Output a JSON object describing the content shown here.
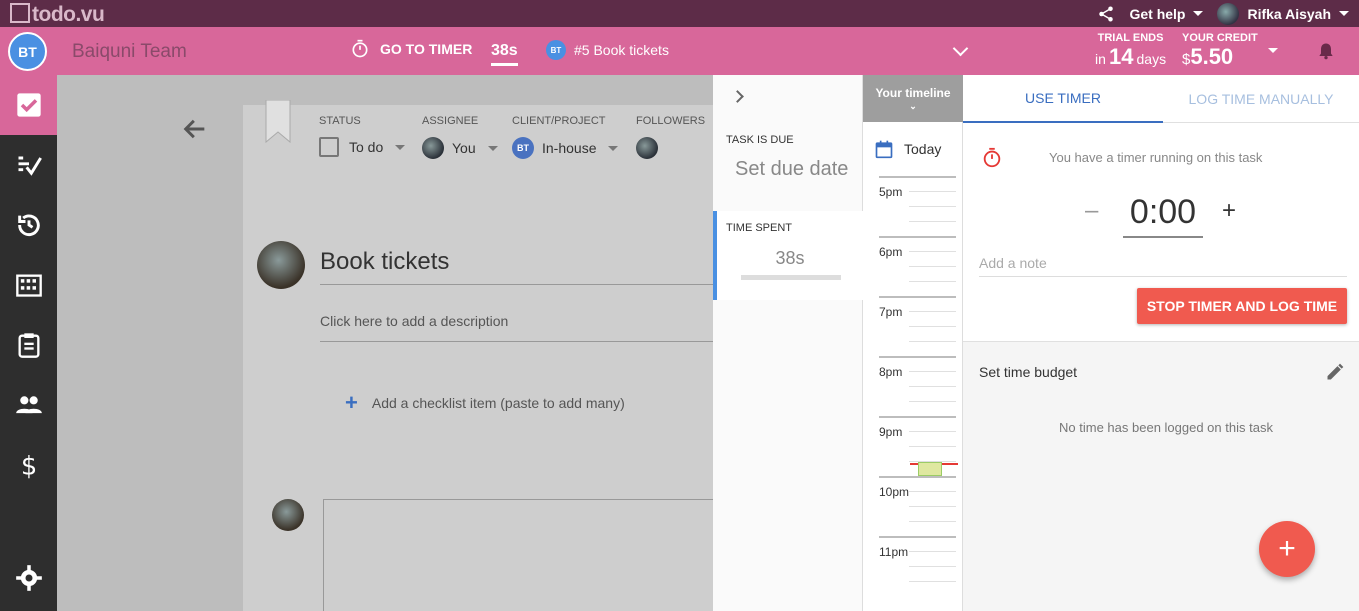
{
  "app": {
    "logo": "todo.vu"
  },
  "topbar": {
    "help_label": "Get help",
    "user_name": "Rifka Aisyah"
  },
  "header": {
    "team_badge": "BT",
    "team_name": "Baiquni Team",
    "goto_timer_label": "GO TO TIMER",
    "timer_value": "38s",
    "task_badge": "BT",
    "task_ref": "#5  Book tickets",
    "trial_label": "TRIAL ENDS",
    "trial_in": "in",
    "trial_days": "14",
    "trial_unit": "days",
    "credit_label": "YOUR CREDIT",
    "credit_currency": "$",
    "credit_amount": "5.50"
  },
  "sidebar": {
    "items": [
      {
        "icon": "check-icon",
        "active": true
      },
      {
        "icon": "tasks-list-icon",
        "active": false
      },
      {
        "icon": "history-icon",
        "active": false
      },
      {
        "icon": "building-icon",
        "active": false
      },
      {
        "icon": "clipboard-icon",
        "active": false
      },
      {
        "icon": "people-icon",
        "active": false
      },
      {
        "icon": "dollar-icon",
        "active": false
      },
      {
        "icon": "gear-icon",
        "active": false
      }
    ]
  },
  "task": {
    "status_label": "STATUS",
    "status_value": "To do",
    "assignee_label": "ASSIGNEE",
    "assignee_value": "You",
    "client_label": "CLIENT/PROJECT",
    "client_badge": "BT",
    "client_value": "In-house",
    "followers_label": "FOLLOWERS",
    "title": "Book tickets",
    "description_placeholder": "Click here to add a description",
    "checklist_placeholder": "Add a checklist item (paste to add many)"
  },
  "due_panel": {
    "due_label": "TASK IS DUE",
    "due_value": "Set due date",
    "spent_label": "TIME SPENT",
    "spent_value": "38s"
  },
  "timeline": {
    "header": "Your timeline",
    "day": "Today",
    "hours": [
      "5pm",
      "6pm",
      "7pm",
      "8pm",
      "9pm",
      "10pm",
      "11pm"
    ]
  },
  "timer_panel": {
    "tab_timer": "USE TIMER",
    "tab_manual": "LOG TIME MANUALLY",
    "running_message": "You have a timer running on this task",
    "minus": "–",
    "clock": "0:00",
    "plus": "+",
    "note_placeholder": "Add a note",
    "stop_button": "STOP TIMER AND LOG TIME",
    "budget_title": "Set time budget",
    "no_log_message": "No time has been logged on this task",
    "fab": "+"
  },
  "colors": {
    "topbar": "#5d2c48",
    "header": "#d8679a",
    "accent": "#3a6ec0",
    "stop": "#f05a4f"
  }
}
